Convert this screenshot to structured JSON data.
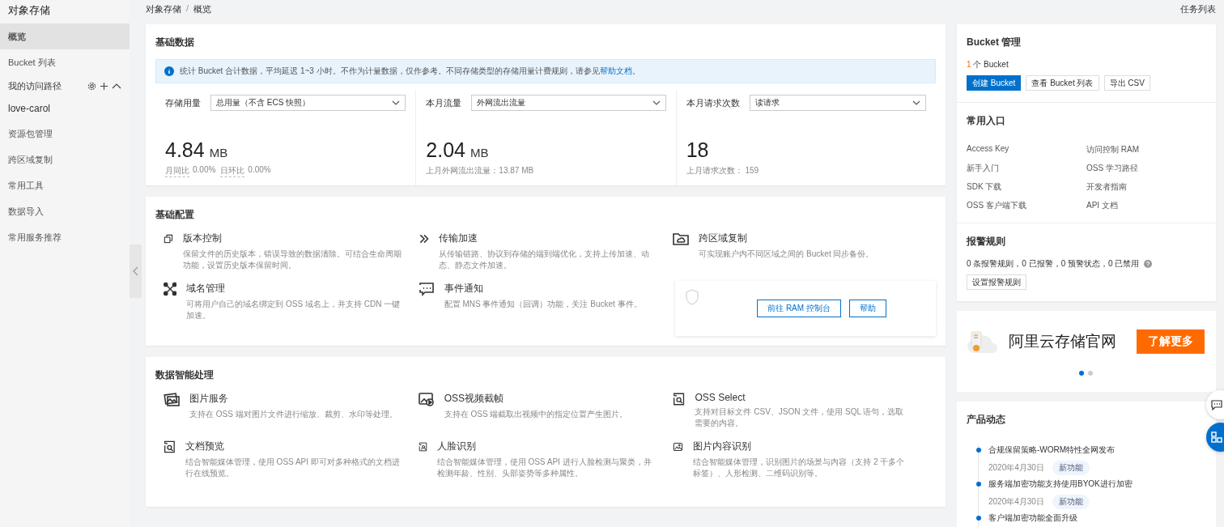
{
  "sidebar": {
    "title": "对象存储",
    "items": [
      {
        "label": "概览",
        "kind": "link",
        "selected": true
      },
      {
        "label": "Bucket 列表",
        "kind": "link",
        "selected": false
      },
      {
        "label": "我的访问路径",
        "kind": "group"
      },
      {
        "label": "love-carol",
        "kind": "path",
        "selected": false
      },
      {
        "label": "资源包管理",
        "kind": "link",
        "selected": false
      },
      {
        "label": "跨区域复制",
        "kind": "link",
        "selected": false
      },
      {
        "label": "常用工具",
        "kind": "link",
        "selected": false
      },
      {
        "label": "数据导入",
        "kind": "link",
        "selected": false
      },
      {
        "label": "常用服务推荐",
        "kind": "link",
        "selected": false
      }
    ]
  },
  "breadcrumb": {
    "items": [
      "对象存储",
      "概览"
    ],
    "separator": "/"
  },
  "task_list": "任务列表",
  "basic_data": {
    "title": "基础数据",
    "notice": {
      "text": "统计 Bucket 合计数据，平均延迟 1~3 小时。不作为计量数据，仅作参考。不同存储类型的存储用量计费规则，请参见",
      "link": "帮助文档",
      "end": "。"
    },
    "metrics": [
      {
        "label": "存储用量",
        "select": "总用量（不含 ECS 快照）",
        "value": "4.84",
        "unit": "MB",
        "notes": [
          {
            "label": "月同比",
            "value": "0.00%"
          },
          {
            "label": "日环比",
            "value": "0.00%"
          }
        ]
      },
      {
        "label": "本月流量",
        "select": "外网流出流量",
        "value": "2.04",
        "unit": "MB",
        "notes": [
          {
            "label": "上月外网流出流量：13.87 MB"
          }
        ]
      },
      {
        "label": "本月请求次数",
        "select": "读请求",
        "value": "18",
        "notes": [
          {
            "label": "上月请求次数： 159"
          }
        ]
      }
    ]
  },
  "basic_config": {
    "title": "基础配置",
    "items": [
      {
        "title": "版本控制",
        "desc": "保留文件的历史版本，错误导致的数据清除。可结合生命周期功能，设置历史版本保留时间。"
      },
      {
        "title": "传输加速",
        "desc": "从传输链路、协议到存储的端到端优化，支持上传加速、动态、静态文件加速。"
      },
      {
        "title": "跨区域复制",
        "desc": "可实现账户内不同区域之间的 Bucket 同步备份。"
      },
      {
        "title": "域名管理",
        "desc": "可将用户自己的域名绑定到 OSS 域名上，并支持 CDN 一键加速。"
      },
      {
        "title": "事件通知",
        "desc": "配置 MNS 事件通知（回调）功能，关注 Bucket 事件。"
      }
    ],
    "overlay": {
      "buttons": [
        "前往 RAM 控制台",
        "帮助"
      ]
    }
  },
  "data_processing": {
    "title": "数据智能处理",
    "items": [
      {
        "title": "图片服务",
        "desc": "支持在 OSS 端对图片文件进行缩放、裁剪、水印等处理。"
      },
      {
        "title": "OSS视频截帧",
        "desc": "支持在 OSS 端截取出视频中的指定位置产生图片。"
      },
      {
        "title": "OSS Select",
        "desc": "支持对目标文件 CSV、JSON 文件，使用 SQL 语句，选取需要的内容。"
      },
      {
        "title": "文档预览",
        "desc": "结合智能媒体管理，使用 OSS API 即可对多种格式的文档进行在线预览。"
      },
      {
        "title": "人脸识别",
        "desc": "结合智能媒体管理，使用 OSS API 进行人脸检测与聚类，并检测年龄、性别、头部姿势等多种属性。"
      },
      {
        "title": "图片内容识别",
        "desc": "结合智能媒体管理，识别图片的场景与内容（支持 2 千多个标签）、人形检测、二维码识别等。"
      }
    ]
  },
  "bucket_management": {
    "title": "Bucket 管理",
    "count": "1",
    "count_label": "个 Bucket",
    "buttons": [
      {
        "label": "创建 Bucket",
        "kind": "primary"
      },
      {
        "label": "查看 Bucket 列表",
        "kind": "default"
      },
      {
        "label": "导出 CSV",
        "kind": "default"
      }
    ]
  },
  "quick_links": {
    "title": "常用入口",
    "links": [
      "Access Key",
      "访问控制 RAM",
      "新手入门",
      "OSS 学习路径",
      "SDK 下载",
      "开发者指南",
      "OSS 客户端下载",
      "API 文档"
    ]
  },
  "alarm_rules": {
    "title": "报警规则",
    "summary": "0 条报警规则，0 已报警，0 预警状态，0 已禁用",
    "button": "设置报警规则"
  },
  "banner": {
    "title": "阿里云存储官网",
    "button": "了解更多",
    "dots": [
      {
        "selected": true
      },
      {
        "selected": false
      }
    ]
  },
  "product_news": {
    "title": "产品动态",
    "items": [
      {
        "title": "合规保留策略-WORM特性全网发布",
        "date": "2020年4月30日",
        "tag": "新功能"
      },
      {
        "title": "服务端加密功能支持使用BYOK进行加密",
        "date": "2020年4月30日",
        "tag": "新功能"
      },
      {
        "title": "客户端加密功能全面升级"
      }
    ]
  }
}
